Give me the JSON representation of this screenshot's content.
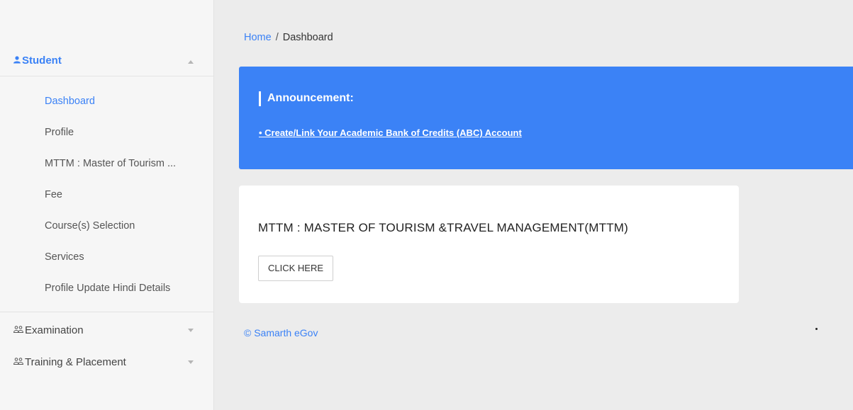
{
  "sidebar": {
    "student": {
      "icon": "person-icon",
      "label": "Student"
    },
    "student_items": [
      {
        "label": "Dashboard"
      },
      {
        "label": "Profile"
      },
      {
        "label": "MTTM : Master of Tourism ..."
      },
      {
        "label": "Fee"
      },
      {
        "label": "Course(s) Selection"
      },
      {
        "label": "Services"
      },
      {
        "label": "Profile Update Hindi Details"
      }
    ],
    "examination": {
      "icon": "users-icon",
      "label": "Examination"
    },
    "training": {
      "icon": "users-icon",
      "label": "Training & Placement"
    }
  },
  "breadcrumb": {
    "home": "Home",
    "separator": "/",
    "current": "Dashboard"
  },
  "announcement": {
    "title": "Announcement:",
    "link": "• Create/Link Your Academic Bank of Credits (ABC) Account"
  },
  "card": {
    "heading": "MTTM : MASTER OF TOURISM &TRAVEL MANAGEMENT(MTTM)",
    "button": "CLICK HERE"
  },
  "footer": {
    "text": "© Samarth eGov"
  },
  "colors": {
    "accent": "#3b82f6",
    "sidebar_bg": "#f6f6f6",
    "page_bg": "#ececec"
  }
}
